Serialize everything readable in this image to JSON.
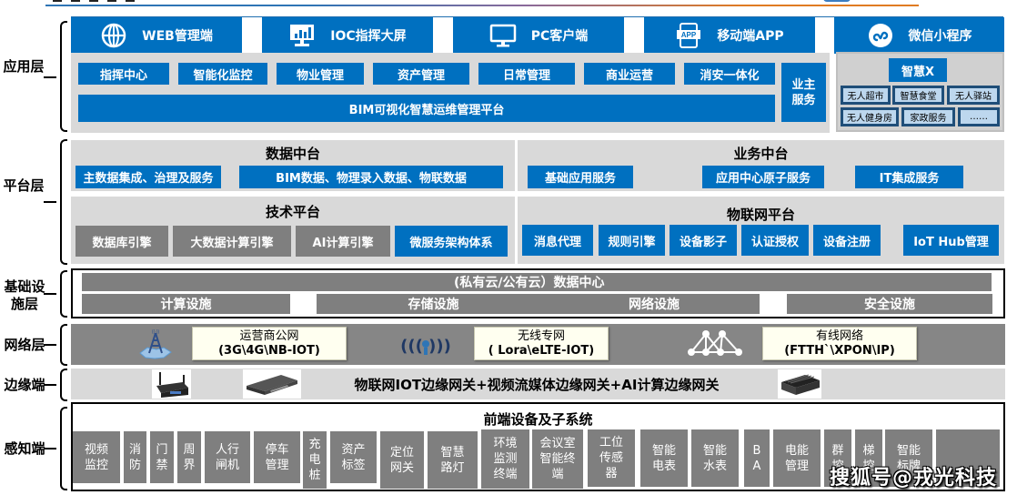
{
  "colors": {
    "primary_blue": "#0070c0",
    "module_gray": "#7f7f7f",
    "panel_gray": "#d9d9d9",
    "network_box": "#fffff0",
    "smartx_cell": "#bdd7ee",
    "accent_orange": "#e07b22"
  },
  "layers": {
    "application": "应用层",
    "platform": "平台层",
    "infrastructure_line1": "基础设",
    "infrastructure_line2": "施层",
    "network": "网络层",
    "edge": "边缘端",
    "perception": "感知端"
  },
  "clients": [
    {
      "icon": "globe-icon",
      "label": "WEB管理端"
    },
    {
      "icon": "dashboard-screen-icon",
      "label": "IOC指挥大屏"
    },
    {
      "icon": "monitor-icon",
      "label": "PC客户端"
    },
    {
      "icon": "mobile-app-icon",
      "label": "移动端APP"
    },
    {
      "icon": "mini-program-icon",
      "label": "微信小程序"
    }
  ],
  "application": {
    "modules": [
      "指挥中心",
      "智能化监控",
      "物业管理",
      "资产管理",
      "日常管理",
      "商业运营",
      "消安一体化"
    ],
    "platform_bar": "BIM可视化智慧运维管理平台",
    "owner_service_line1": "业主",
    "owner_service_line2": "服务",
    "smart_x": {
      "title": "智慧X",
      "row1": [
        "无人超市",
        "智慧食堂",
        "无人驿站"
      ],
      "row2": [
        "无人健身房",
        "家政服务",
        "……"
      ]
    }
  },
  "platform": {
    "data_center": {
      "title": "数据中台",
      "items": [
        "主数据集成、治理及服务",
        "BIM数据、物理录入数据、物联数据"
      ]
    },
    "business_center": {
      "title": "业务中台",
      "items": [
        "基础应用服务",
        "应用中心原子服务",
        "IT集成服务"
      ]
    },
    "tech_platform": {
      "title": "技术平台",
      "items": [
        "数据库引擎",
        "大数据计算引擎",
        "AI计算引擎",
        "微服务架构体系"
      ]
    },
    "iot_platform": {
      "title": "物联网平台",
      "items": [
        "消息代理",
        "规则引擎",
        "设备影子",
        "认证授权",
        "设备注册",
        "IoT Hub管理"
      ]
    }
  },
  "infrastructure": {
    "title": "(私有云/公有云）数据中心",
    "items": [
      "计算设施",
      "存储设施",
      "网络设施",
      "安全设施"
    ]
  },
  "network": {
    "items": [
      {
        "icon": "cell-tower-icon",
        "line1": "运营商公网",
        "line2": "(3G\\4G\\NB-IOT)"
      },
      {
        "icon": "wireless-signal-icon",
        "line1": "无线专网",
        "line2": "( Lora\\eLTE-IOT)"
      },
      {
        "icon": "network-topology-icon",
        "line1": "有线网络",
        "line2": "(FTTH`\\XPON\\IP)"
      }
    ]
  },
  "edge": {
    "title": "物联网IOT边缘网关+视频流媒体边缘网关+AI计算边缘网关",
    "devices": [
      "wifi-gateway-icon",
      "rack-server-icon",
      "fanless-box-icon"
    ]
  },
  "perception": {
    "title": "前端设备及子系统",
    "items": [
      [
        "视频",
        "监控"
      ],
      [
        "消",
        "防"
      ],
      [
        "门",
        "禁"
      ],
      [
        "周",
        "界"
      ],
      [
        "人行",
        "闸机"
      ],
      [
        "停车",
        "管理"
      ],
      [
        "充",
        "电",
        "桩"
      ],
      [
        "资产",
        "标签"
      ],
      [
        "定位",
        "网关"
      ],
      [
        "智慧",
        "路灯"
      ],
      [
        "环境",
        "监测",
        "终端"
      ],
      [
        "会议室",
        "智能终",
        "端"
      ],
      [
        "工位",
        "传感",
        "器"
      ],
      [
        "智能",
        "电表"
      ],
      [
        "智能",
        "水表"
      ],
      [
        "B",
        "A"
      ],
      [
        "电能",
        "管理"
      ],
      [
        "群",
        "控"
      ],
      [
        "梯",
        "控"
      ],
      [
        "智能",
        "标牌"
      ],
      [
        ""
      ]
    ]
  },
  "watermark": "搜狐号@戎光科技"
}
